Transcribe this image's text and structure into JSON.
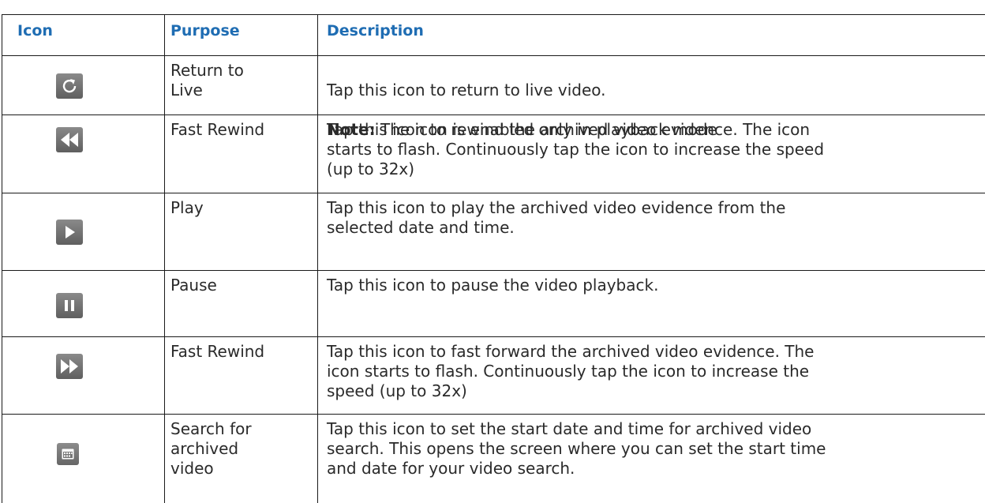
{
  "table": {
    "headers": {
      "icon": "Icon",
      "purpose": "Purpose",
      "description": "Description"
    },
    "rows": [
      {
        "icon": "return-to-live-icon",
        "purpose": "Return to\nLive",
        "description": "Tap this icon to return to live video.",
        "note_label": "Note:",
        "note_text": " The icon is enabled only in playback mode"
      },
      {
        "icon": "fast-rewind-icon",
        "purpose": "Fast Rewind",
        "description": "Tap this icon to rewind the archived video evidence. The icon\nstarts to flash. Continuously tap the icon to increase the speed\n(up to 32x)"
      },
      {
        "icon": "play-icon",
        "purpose": "Play",
        "description": "Tap this icon to play the archived video evidence from the\nselected date and time."
      },
      {
        "icon": "pause-icon",
        "purpose": "Pause",
        "description": "Tap this icon to pause the video playback."
      },
      {
        "icon": "fast-forward-icon",
        "purpose": "Fast Rewind",
        "description": "Tap this icon to fast forward the archived video evidence. The\nicon starts to flash. Continuously tap the icon to increase the\nspeed (up to 32x)"
      },
      {
        "icon": "calendar-icon",
        "purpose": "Search for\narchived\nvideo",
        "description": "Tap this icon to set the start date and time for archived video\nsearch. This opens the screen where you can set the start time\nand date for your video search."
      }
    ]
  },
  "colors": {
    "header_text": "#1f6db3",
    "icon_bg": "#6e6e6e",
    "rule": "#1a1a1a"
  }
}
